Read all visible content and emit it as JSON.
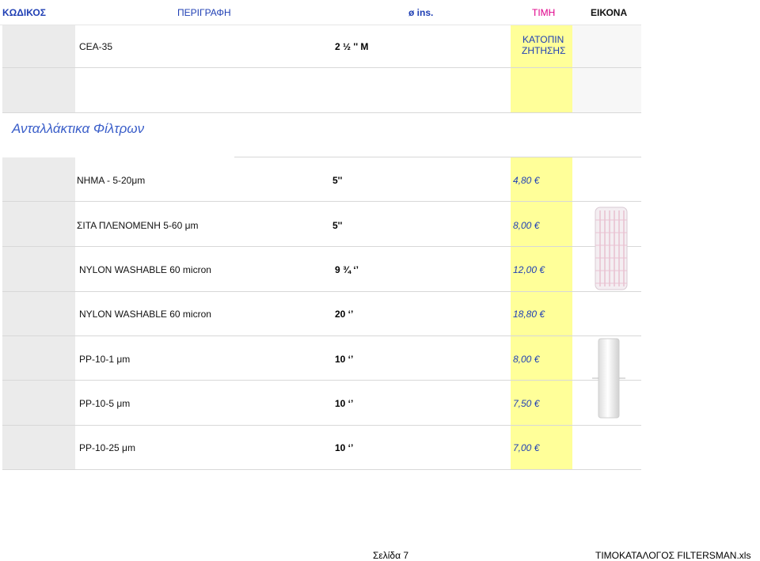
{
  "header": {
    "code": "ΚΩΔΙΚΟΣ",
    "description": "ΠΕΡΙΓΡΑΦΗ",
    "diameter": "ø ins.",
    "price": "ΤΙΜΗ",
    "image": "ΕΙΚΟΝΑ"
  },
  "top_row": {
    "description": "CEA-35",
    "diameter": "2 ½ '' M",
    "price_line1": "ΚΑΤΟΠΙΝ",
    "price_line2": "ΖΗΤΗΣΗΣ"
  },
  "section_title": "Ανταλλάκτικα Φίλτρων",
  "rows": [
    {
      "description": "ΝΗΜΑ - 5-20μm",
      "diameter": "5''",
      "price": "4,80 €"
    },
    {
      "description": "ΣΙΤΑ ΠΛΕΝΟΜΕΝΗ 5-60 μm",
      "diameter": "5''",
      "price": "8,00 €"
    },
    {
      "description": "NYLON WASHABLE 60 micron",
      "diameter": "9 ¾ ‘’",
      "price": "12,00 €"
    },
    {
      "description": "NYLON WASHABLE 60 micron",
      "diameter": "20 ‘’",
      "price": "18,80 €"
    },
    {
      "description": "PP-10-1 μm",
      "diameter": "10 ‘’",
      "price": "8,00 €"
    },
    {
      "description": "PP-10-5 μm",
      "diameter": "10 ‘’",
      "price": "7,50 €"
    },
    {
      "description": "PP-10-25 μm",
      "diameter": "10 ‘’",
      "price": "7,00 €"
    }
  ],
  "footer": {
    "page": "Σελίδα 7",
    "file": "ΤΙΜΟΚΑΤΑΛΟΓΟΣ FILTERSMAN.xls"
  },
  "colors": {
    "header_text": "#1f3fb4",
    "price_column": "#ffff99",
    "code_column": "#ebebeb",
    "section_title": "#3a5ec9"
  }
}
